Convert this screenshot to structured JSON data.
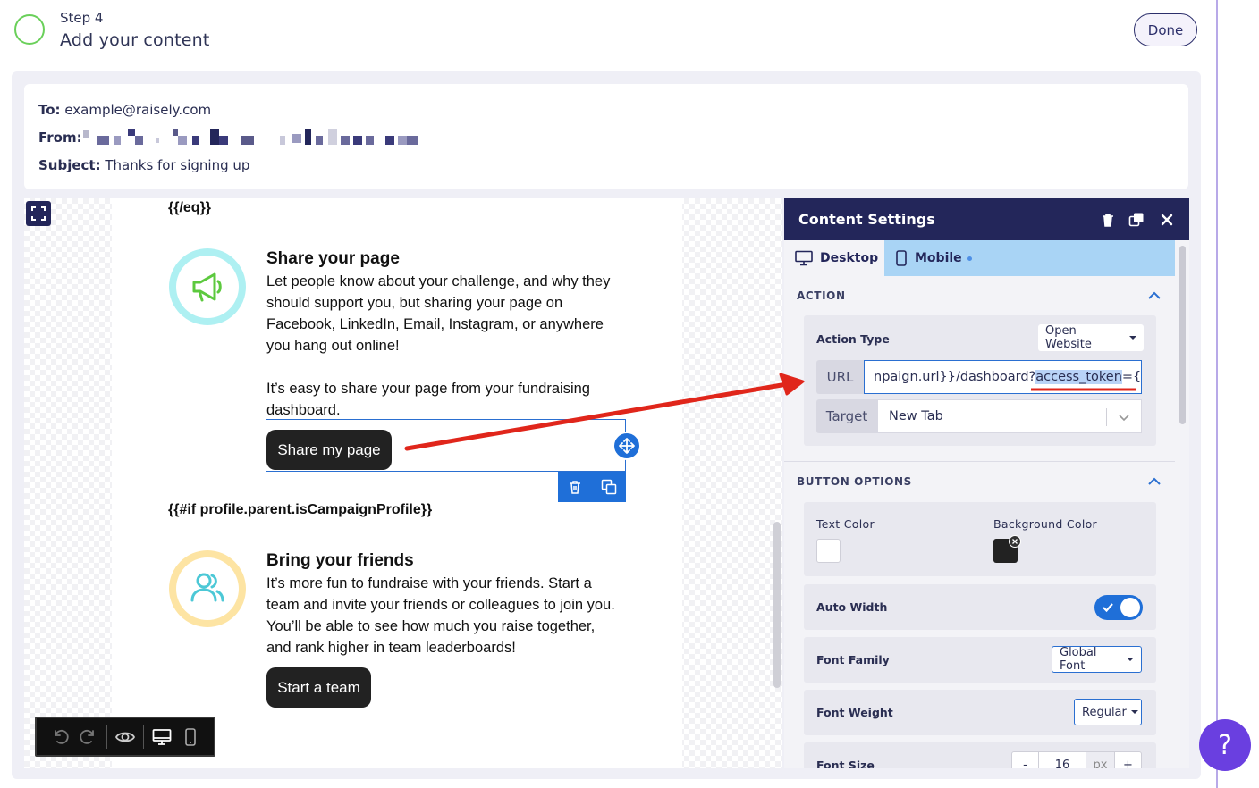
{
  "step": {
    "number_label": "Step 4",
    "title": "Add your content",
    "done_label": "Done"
  },
  "email_meta": {
    "to_label": "To:",
    "to_value": "example@raisely.com",
    "from_label": "From:",
    "subject_label": "Subject:",
    "subject_value": "Thanks for signing up"
  },
  "email": {
    "tag_eq_close": "{{/eq}}",
    "share": {
      "title": "Share your page",
      "text1": "Let people know about your challenge, and why they should support you, but sharing your page on Facebook, LinkedIn, Email, Instagram, or anywhere you hang out online!",
      "text2": "It’s easy to share your page from your fundraising dashboard.",
      "button": "Share my page"
    },
    "tag_if_campaign": "{{#if profile.parent.isCampaignProfile}}",
    "friends": {
      "title": "Bring your friends",
      "text": "It’s more fun to fundraise with your friends. Start a team and invite your friends or colleagues to join you. You’ll be able to see how much you raise together, and rank higher in team leaderboards!",
      "button": "Start a team"
    }
  },
  "settings": {
    "title": "Content Settings",
    "tabs": {
      "desktop": "Desktop",
      "mobile": "Mobile"
    },
    "action": {
      "section_label": "ACTION",
      "action_type_label": "Action Type",
      "action_type_value": "Open Website",
      "url_label": "URL",
      "url_prefix": "npaign.url}}/dashboard?",
      "url_highlight": "access_token",
      "url_suffix": "={",
      "target_label": "Target",
      "target_value": "New Tab"
    },
    "button_options": {
      "section_label": "BUTTON OPTIONS",
      "text_color_label": "Text Color",
      "bg_color_label": "Background Color",
      "auto_width_label": "Auto Width",
      "font_family_label": "Font Family",
      "font_family_value": "Global Font",
      "font_weight_label": "Font Weight",
      "font_weight_value": "Regular",
      "font_size_label": "Font Size",
      "font_size_value": "16",
      "font_size_unit": "px",
      "minus": "-",
      "plus": "+"
    }
  },
  "help_label": "?",
  "colors": {
    "navy": "#23265a",
    "accent_blue": "#1f6fd8",
    "step_green": "#6ad05a",
    "annotation_red": "#e0261b",
    "help_purple": "#6a3fe0",
    "text_color_swatch": "#ffffff",
    "bg_color_swatch": "#222222"
  }
}
